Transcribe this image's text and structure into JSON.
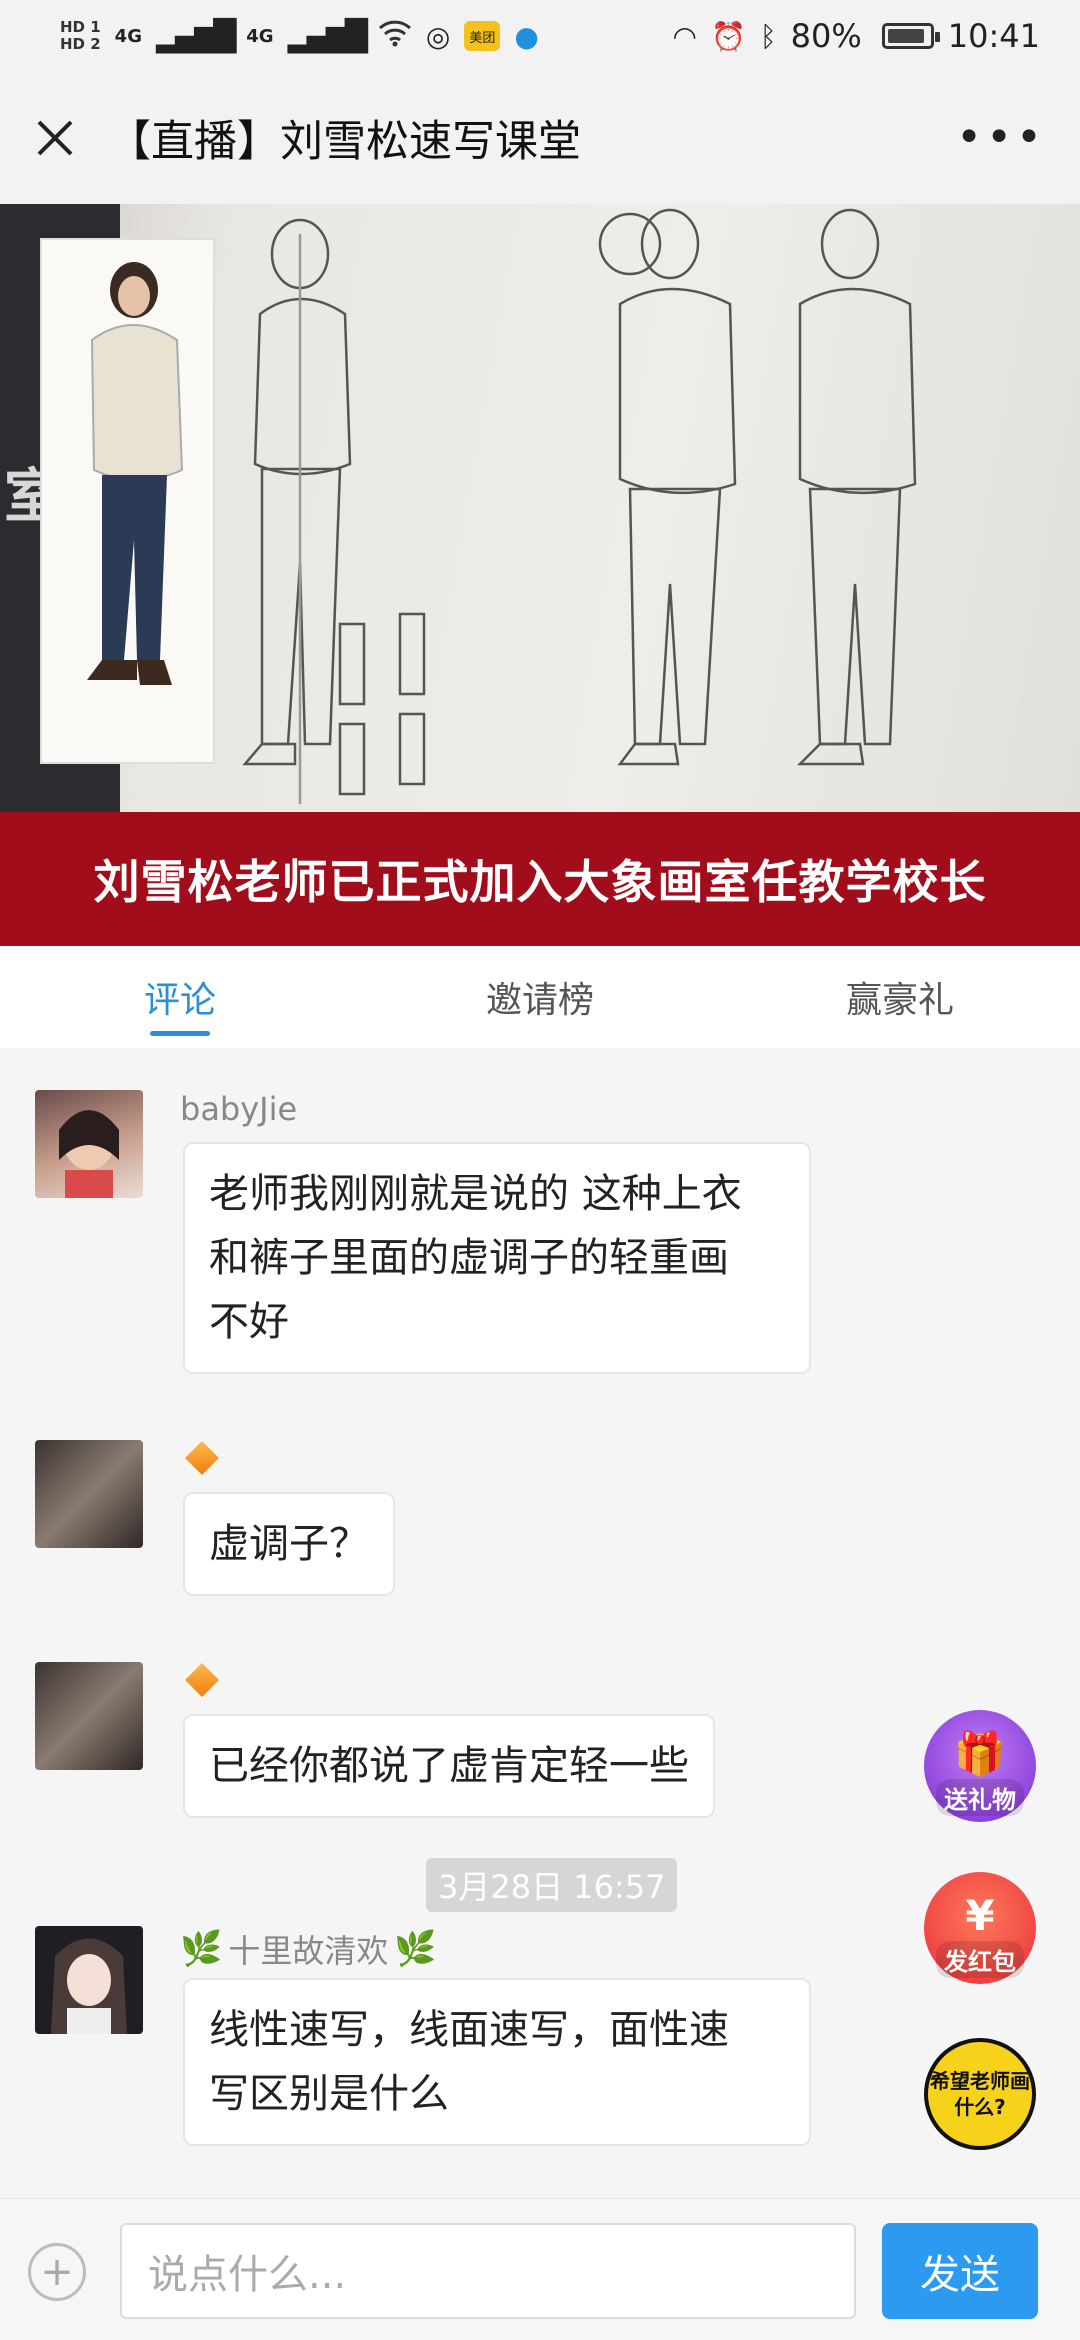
{
  "status_bar": {
    "hd1": "HD 1",
    "hd2": "HD 2",
    "net1": "4G",
    "net2": "4G",
    "app_badge": "美团",
    "battery_percent": "80%",
    "time": "10:41"
  },
  "header": {
    "close_icon": "close-icon",
    "title": "【直播】刘雪松速写课堂",
    "more_icon": "more-icon"
  },
  "video": {
    "banner_text": "刘雪松老师已正式加入大象画室任教学校长",
    "side_char": "室"
  },
  "tabs": [
    {
      "label": "评论",
      "active": true
    },
    {
      "label": "邀请榜",
      "active": false
    },
    {
      "label": "赢豪礼",
      "active": false
    }
  ],
  "comments": [
    {
      "user": "babyJie",
      "text": "老师我刚刚就是说的 这种上衣\n和裤子里面的虚调子的轻重画\n不好"
    },
    {
      "user": "",
      "text": "虚调子？"
    },
    {
      "user": "",
      "text": "已经你都说了虚肯定轻一些"
    },
    {
      "user": "十里故清欢",
      "text": "线性速写，线面速写，面性速\n写区别是什么"
    }
  ],
  "timestamp": "3月28日 16:57",
  "fabs": {
    "gift_label": "送礼物",
    "redpacket_label": "发红包",
    "ask_label": "希望老师画什么?"
  },
  "input_bar": {
    "placeholder": "说点什么...",
    "send_label": "发送"
  },
  "colors": {
    "accent": "#2b8fd6",
    "banner": "#a10d1a",
    "send": "#2b9af0"
  }
}
